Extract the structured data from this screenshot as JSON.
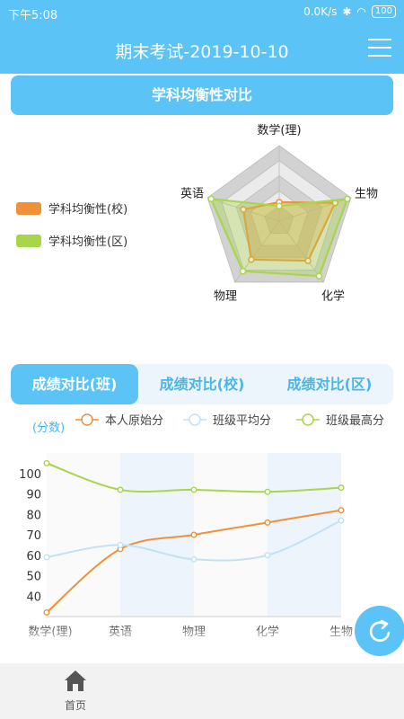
{
  "status_bar": {
    "time": "下午5:08",
    "speed": "0.0K/s",
    "battery": "100"
  },
  "app_bar": {
    "title": "期末考试-2019-10-10"
  },
  "radar": {
    "header": "学科均衡性对比",
    "axes": [
      "数学(理)",
      "生物",
      "化学",
      "物理",
      "英语"
    ],
    "legend": [
      {
        "name": "学科均衡性(校)",
        "color": "#f0913a"
      },
      {
        "name": "学科均衡性(区)",
        "color": "#a8d64a"
      }
    ],
    "series": [
      {
        "name": "学科均衡性(校)",
        "values": [
          0.25,
          0.78,
          0.65,
          0.63,
          0.5
        ]
      },
      {
        "name": "学科均衡性(区)",
        "values": [
          0.2,
          0.95,
          0.9,
          0.82,
          0.95
        ]
      }
    ],
    "ring_colors": [
      "#ebebeb",
      "#d2d2d2"
    ]
  },
  "tabs": [
    {
      "label": "成绩对比(班)",
      "active": true
    },
    {
      "label": "成绩对比(校)",
      "active": false
    },
    {
      "label": "成绩对比(区)",
      "active": false
    }
  ],
  "chart_data": {
    "type": "line",
    "ylabel": "(分数)",
    "categories": [
      "数学(理)",
      "英语",
      "物理",
      "化学",
      "生物"
    ],
    "ylim": [
      30,
      110
    ],
    "yticks": [
      40,
      50,
      60,
      70,
      80,
      90,
      100
    ],
    "series": [
      {
        "name": "本人原始分",
        "color": "#f0913a",
        "values": [
          32,
          63,
          70,
          76,
          82
        ]
      },
      {
        "name": "班级平均分",
        "color": "#c2e2f4",
        "values": [
          59,
          65,
          58,
          60,
          77
        ]
      },
      {
        "name": "班级最高分",
        "color": "#a8d64a",
        "values": [
          105,
          92,
          92,
          91,
          93
        ]
      }
    ],
    "grid": true
  },
  "bottom_nav": {
    "home_label": "首页"
  }
}
